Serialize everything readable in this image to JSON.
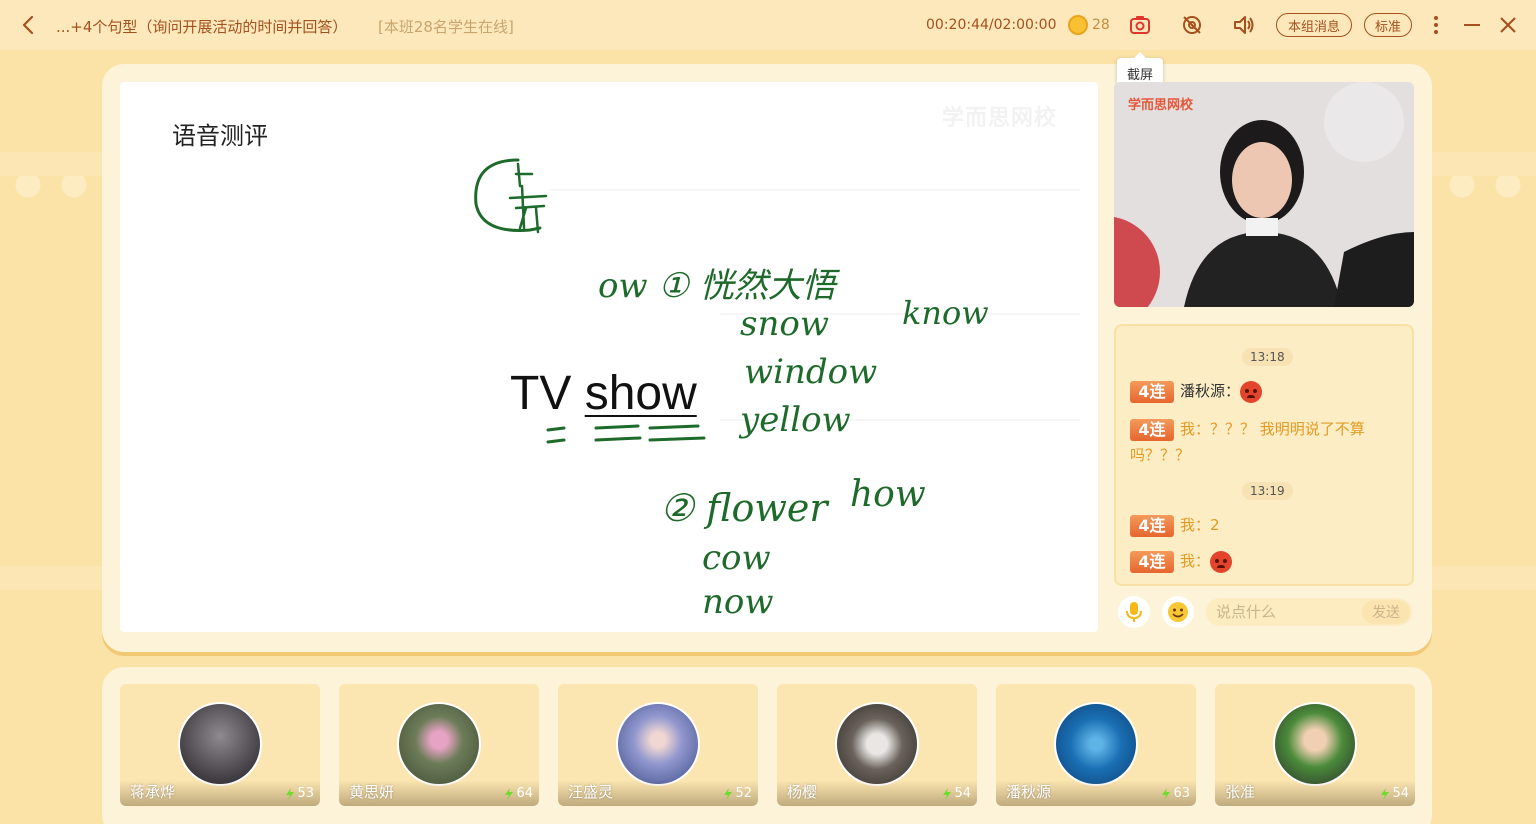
{
  "titlebar": {
    "title": "...+4个句型（询问开展活动的时间并回答）",
    "online": "[本班28名学生在线]",
    "timer": "00:20:44/02:00:00",
    "coins": "28",
    "group_msg_label": "本组消息",
    "quality_label": "标准",
    "screenshot_tooltip": "截屏"
  },
  "whiteboard": {
    "heading": "语音测评",
    "watermark": "学而思网校",
    "main_text_1": "TV",
    "main_text_2": "show",
    "handwriting": {
      "g1": "ow ① 恍然大悟",
      "w1": "snow",
      "w2": "window",
      "w3": "yellow",
      "w4": "know",
      "g2": "② flower",
      "w5": "how",
      "w6": "cow",
      "w7": "now"
    }
  },
  "teacher": {
    "logo": "学而思网校"
  },
  "chat": {
    "time1": "13:18",
    "time2": "13:19",
    "badge": "4连",
    "messages": [
      {
        "name": "潘秋源：",
        "text": "",
        "emoji": "angry-face"
      },
      {
        "name": "我：",
        "text": "？？？ 我明明说了不算吗？？？",
        "emoji": ""
      },
      {
        "name": "我：",
        "text": "2",
        "emoji": ""
      },
      {
        "name": "我：",
        "text": "",
        "emoji": "angry-face"
      }
    ],
    "input_placeholder": "说点什么",
    "send_label": "发送"
  },
  "students": [
    {
      "name": "蒋承烨",
      "energy": "53",
      "avatar_color": "#3a3438"
    },
    {
      "name": "黄思妍",
      "energy": "64",
      "avatar_color": "#7c8a63"
    },
    {
      "name": "汪盛灵",
      "energy": "52",
      "avatar_color": "#8f90c2"
    },
    {
      "name": "杨樱",
      "energy": "54",
      "avatar_color": "#5d5652"
    },
    {
      "name": "潘秋源",
      "energy": "63",
      "avatar_color": "#1a70b6"
    },
    {
      "name": "张准",
      "energy": "54",
      "avatar_color": "#d8b26a"
    }
  ],
  "colors": {
    "accent": "#a4511d",
    "background": "#fbe2a6",
    "handwriting": "#1e6a2b",
    "badge": "#e6662f"
  }
}
